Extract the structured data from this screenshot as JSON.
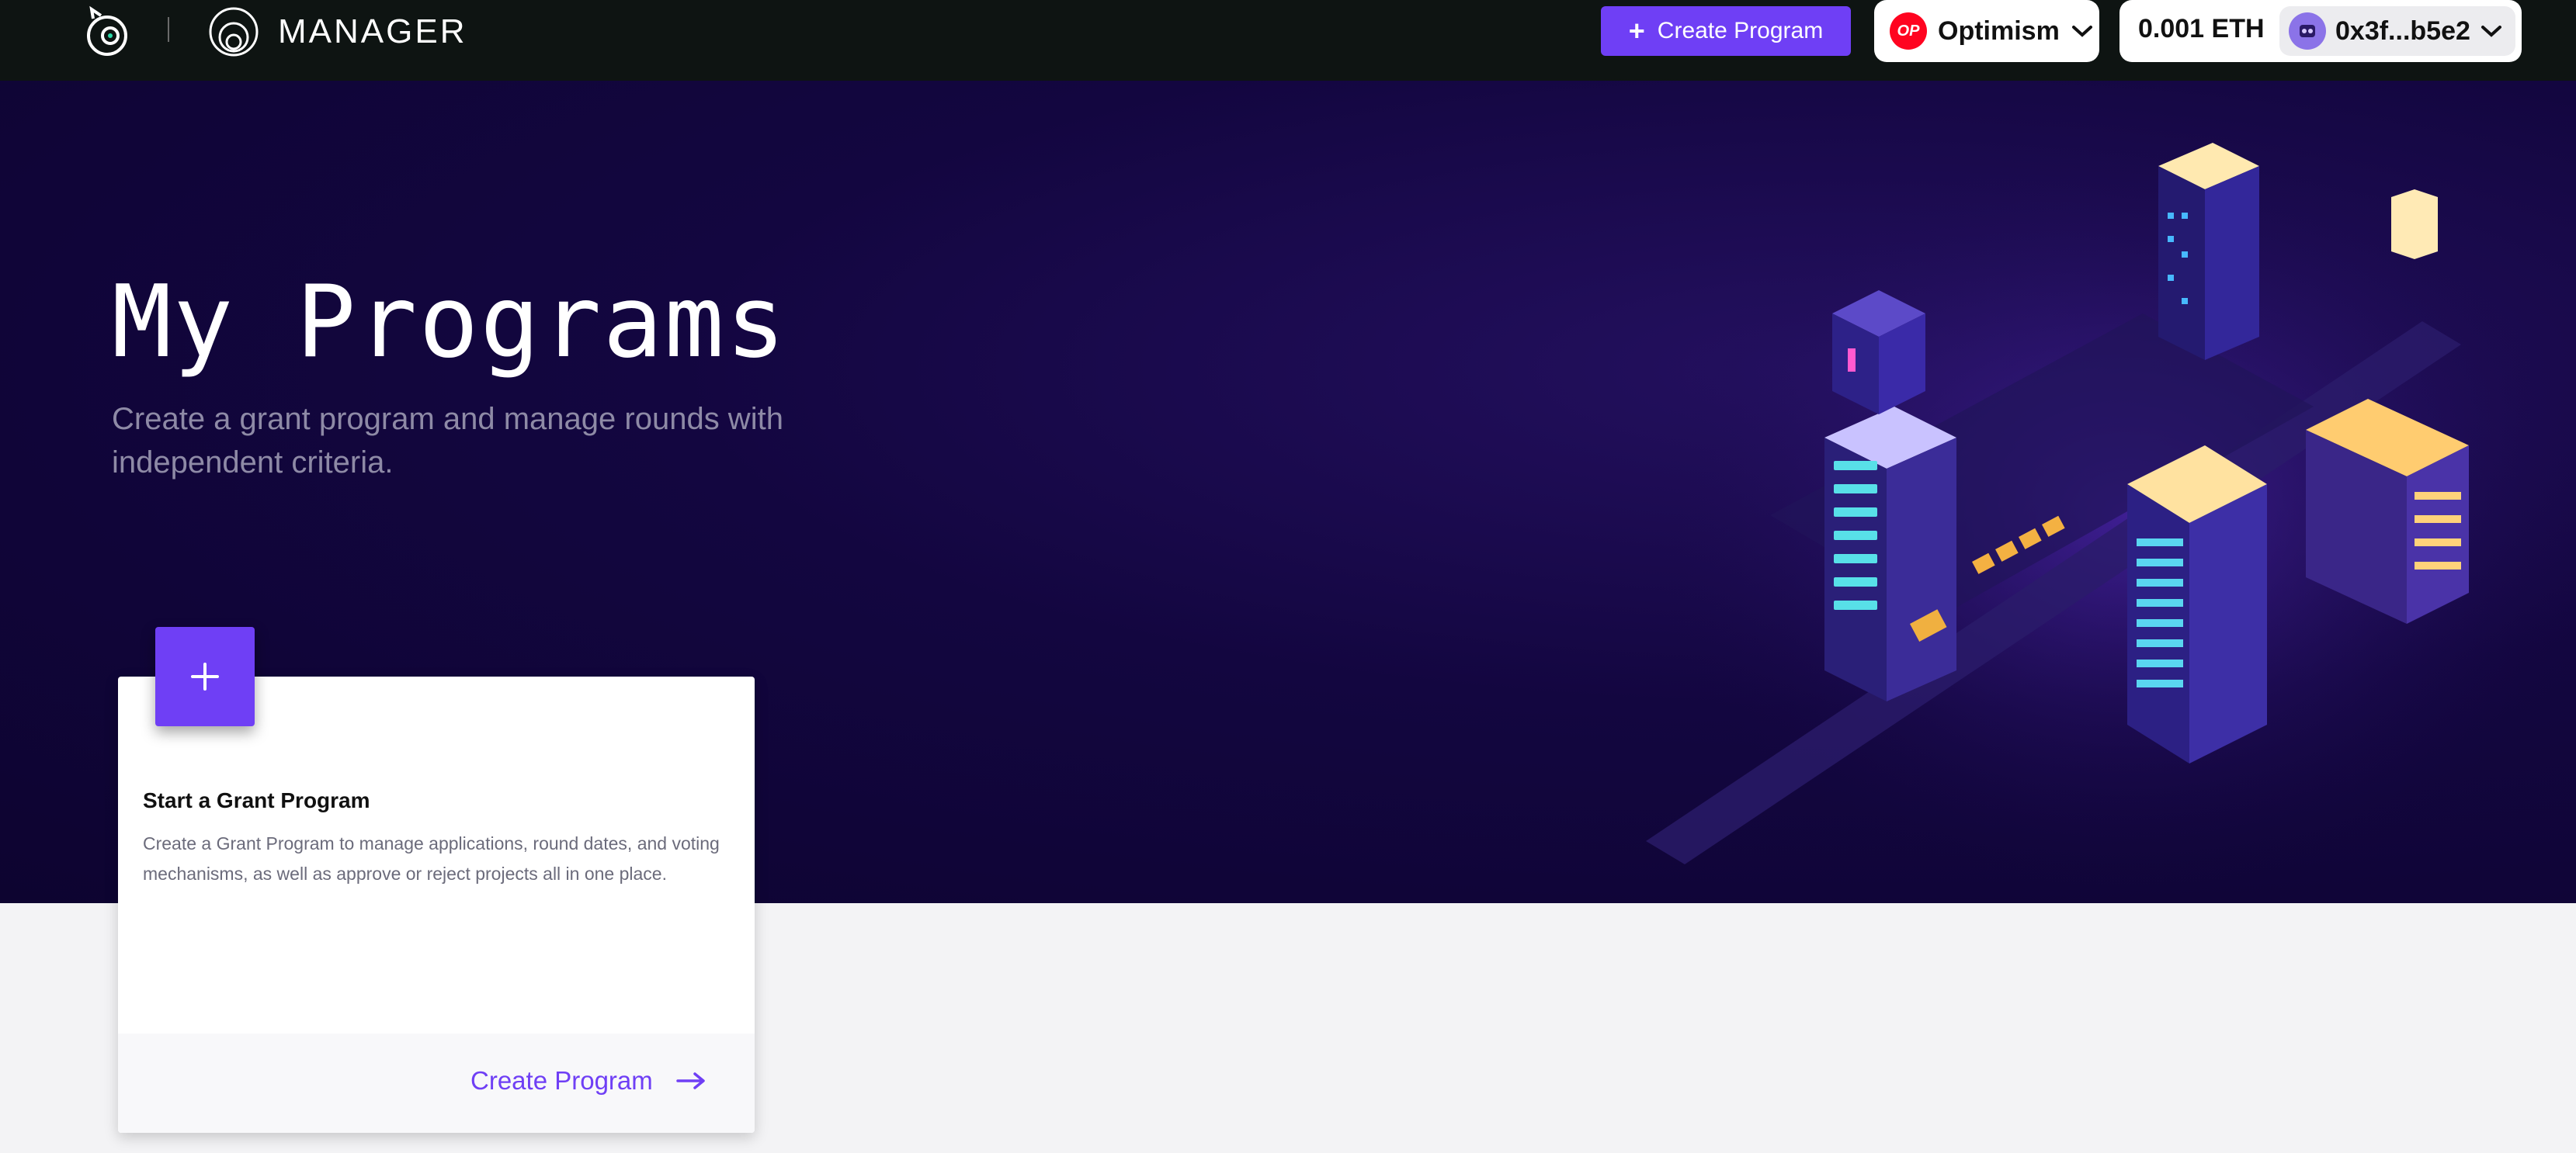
{
  "header": {
    "app_name": "MANAGER",
    "create_button_label": "Create Program",
    "chain": {
      "name": "Optimism",
      "badge": "OP",
      "badge_color": "#ff0420"
    },
    "wallet": {
      "balance": "0.001 ETH",
      "address": "0x3f...b5e2"
    },
    "icons": [
      "gitcoin-logo-icon",
      "manager-logo-icon",
      "plus-icon",
      "chevron-down-icon",
      "wallet-avatar-icon"
    ]
  },
  "hero": {
    "title": "My Programs",
    "subtitle": "Create a grant program and manage rounds with independent criteria."
  },
  "card": {
    "title": "Start a Grant Program",
    "description": "Create a Grant Program to manage applications, round dates, and voting mechanisms, as well as approve or reject projects all in one place.",
    "link_label": "Create Program",
    "icons": [
      "plus-icon",
      "arrow-right-icon"
    ]
  },
  "colors": {
    "accent": "#6f3ff5",
    "topbar": "#0e1412",
    "hero_bg": "#130640",
    "page_bg": "#f3f3f5"
  }
}
